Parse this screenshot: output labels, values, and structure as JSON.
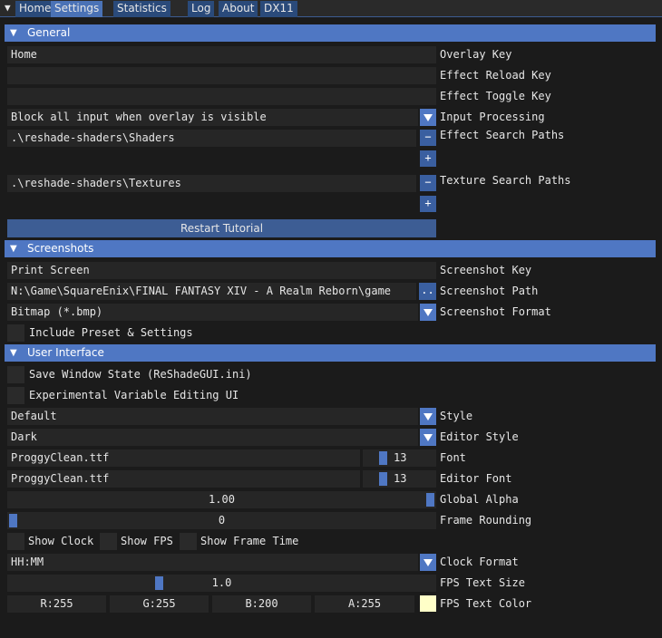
{
  "tabs": [
    {
      "label": "Home",
      "active": false
    },
    {
      "label": "Settings",
      "active": true
    },
    {
      "label": "Statistics",
      "active": false
    },
    {
      "label": "Log",
      "active": false
    },
    {
      "label": "About",
      "active": false
    },
    {
      "label": "DX11",
      "active": false
    }
  ],
  "general": {
    "header": "General",
    "overlay_key": {
      "value": "Home",
      "label": "Overlay Key"
    },
    "effect_reload_key": {
      "value": "",
      "label": "Effect Reload Key"
    },
    "effect_toggle_key": {
      "value": "",
      "label": "Effect Toggle Key"
    },
    "input_processing": {
      "value": "Block all input when overlay is visible",
      "label": "Input Processing"
    },
    "effect_search_paths": {
      "value": ".\\reshade-shaders\\Shaders",
      "label": "Effect Search Paths"
    },
    "texture_search_paths": {
      "value": ".\\reshade-shaders\\Textures",
      "label": "Texture Search Paths"
    },
    "minus": "−",
    "plus": "+",
    "restart_tutorial": "Restart Tutorial"
  },
  "screenshots": {
    "header": "Screenshots",
    "screenshot_key": {
      "value": "Print Screen",
      "label": "Screenshot Key"
    },
    "screenshot_path": {
      "value": "N:\\Game\\SquareEnix\\FINAL FANTASY XIV - A Realm Reborn\\game",
      "label": "Screenshot Path",
      "browse": ".."
    },
    "screenshot_format": {
      "value": "Bitmap (*.bmp)",
      "label": "Screenshot Format"
    },
    "include_preset": {
      "label": "Include Preset & Settings",
      "checked": false
    }
  },
  "ui": {
    "header": "User Interface",
    "save_window_state": {
      "label": "Save Window State (ReShadeGUI.ini)",
      "checked": false
    },
    "experimental_editing": {
      "label": "Experimental Variable Editing UI",
      "checked": false
    },
    "style": {
      "value": "Default",
      "label": "Style"
    },
    "editor_style": {
      "value": "Dark",
      "label": "Editor Style"
    },
    "font": {
      "value": "ProggyClean.ttf",
      "size": "13",
      "size_level": 0.1,
      "label": "Font"
    },
    "editor_font": {
      "value": "ProggyClean.ttf",
      "size": "13",
      "size_level": 0.1,
      "label": "Editor Font"
    },
    "global_alpha": {
      "value": "1.00",
      "level": 1.0,
      "label": "Global Alpha"
    },
    "frame_rounding": {
      "value": "0",
      "level": 0.0,
      "label": "Frame Rounding"
    },
    "show_clock": {
      "label": "Show Clock",
      "checked": false
    },
    "show_fps": {
      "label": "Show FPS",
      "checked": false
    },
    "show_frame_time": {
      "label": "Show Frame Time",
      "checked": false
    },
    "clock_format": {
      "value": "HH:MM",
      "label": "Clock Format"
    },
    "fps_text_size": {
      "value": "1.0",
      "level": 0.35,
      "label": "FPS Text Size"
    },
    "fps_text_color": {
      "r": "R:255",
      "g": "G:255",
      "b": "B:200",
      "a": "A:255",
      "swatch": "#ffffc8",
      "label": "FPS Text Color"
    }
  },
  "colors": {
    "accent": "#4f77c3",
    "background": "#1b1b1b",
    "field": "#262626"
  }
}
